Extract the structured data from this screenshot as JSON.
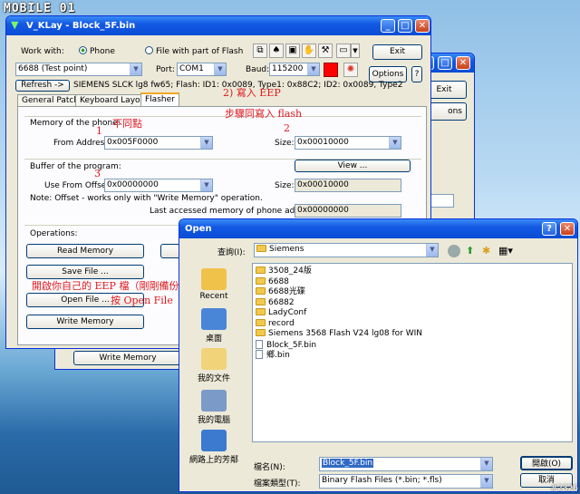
{
  "watermark": {
    "logo": "MOBILE 01",
    "id": "#2326"
  },
  "back_window": {
    "exit_label": "Exit",
    "options_partial": "ons",
    "write_memory": "Write Memory"
  },
  "main_window": {
    "title": "V_KLay - Block_5F.bin",
    "work_with_label": "Work with:",
    "radio_phone": "Phone",
    "radio_file": "File with part of Flash",
    "exit_label": "Exit",
    "options_label": "Options",
    "help_label": "?",
    "phone_model": "6688 (Test point)",
    "port_label": "Port:",
    "port_value": "COM1",
    "baud_label": "Baud:",
    "baud_value": "115200",
    "refresh_label": "Refresh ->",
    "phone_info": "SIEMENS SLCK lg8 fw65; Flash: ID1: 0x0089, Type1: 0x88C2; ID2: 0x0089, Type2",
    "tabs": [
      "General Patch",
      "Keyboard Layout",
      "Flasher"
    ],
    "memory_group": "Memory of the phone:",
    "from_address_label": "From Address:",
    "from_address": "0x005F0000",
    "size_label": "Size:",
    "size_value": "0x00010000",
    "buffer_group": "Buffer of the program:",
    "view_label": "View ...",
    "use_offset_label": "Use From Offset:",
    "offset_value": "0x00000000",
    "buffer_size_label": "Size:",
    "buffer_size": "0x00010000",
    "note": "Note: Offset - works only with \"Write Memory\" operation.",
    "last_accessed_label": "Last accessed memory of phone address:",
    "last_accessed": "0x00000000",
    "operations_group": "Operations:",
    "read_memory": "Read Memory",
    "save_file": "Save File ...",
    "open_file": "Open File ...",
    "write_memory": "Write Memory"
  },
  "annotations": {
    "write_eep": "2) 寫入 EEP",
    "step_flash": "步驟同寫入 flash",
    "num1": "1",
    "num2": "2",
    "num3": "3",
    "not_same": "不同點",
    "open_eep": "開啟你自己的 EEP 檔（剛剛備份的",
    "press_open": "按 Open File"
  },
  "open_dialog": {
    "title": "Open",
    "help": "?",
    "close": "X",
    "lookin_label": "查詢(I):",
    "lookin_value": "Siemens",
    "sidebar": [
      "Recent",
      "桌面",
      "我的文件",
      "我的電腦",
      "網路上的芳鄰"
    ],
    "folders": [
      "3508_24版",
      "6688",
      "6688光碟",
      "66882",
      "LadyConf",
      "record",
      "Siemens 3568 Flash V24 lg08 for WIN"
    ],
    "files": [
      "Block_5F.bin",
      "鄉.bin"
    ],
    "filename_label": "檔名(N):",
    "filename_value": "Block_5F.bin",
    "filetype_label": "檔案類型(T):",
    "filetype_value": "Binary Flash Files (*.bin; *.fls)",
    "open_button": "開啟(O)",
    "cancel_button": "取消"
  },
  "colors": {
    "titlebar": "#0a4dd6",
    "annotation_red": "#e0181f",
    "baud_red": "#ff0000"
  }
}
